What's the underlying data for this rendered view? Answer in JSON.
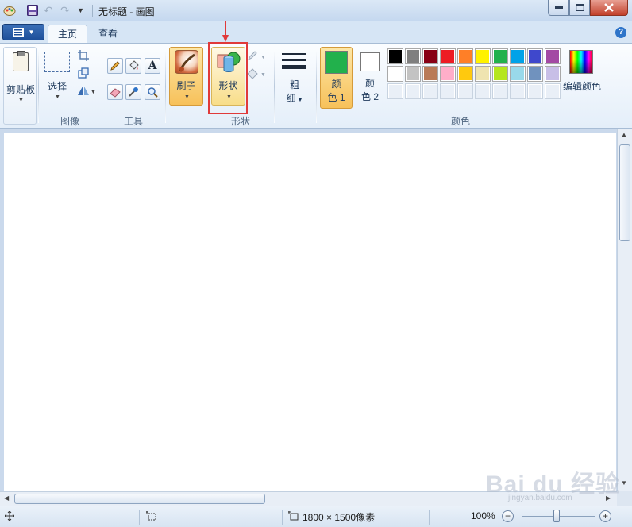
{
  "window": {
    "title": "无标题 - 画图"
  },
  "tabs": {
    "home": "主页",
    "view": "查看"
  },
  "ribbon": {
    "clipboard": {
      "label": "剪贴板"
    },
    "image": {
      "group_label": "图像",
      "select_label": "选择"
    },
    "tools": {
      "group_label": "工具"
    },
    "brushes": {
      "label": "刷子"
    },
    "shapes": {
      "label": "形状",
      "group_label": "形状"
    },
    "size": {
      "label_line1": "粗",
      "label_line2": "细"
    },
    "colors": {
      "group_label": "颜色",
      "color1": {
        "line1": "颜",
        "line2": "色 1",
        "value": "#22b14c"
      },
      "color2": {
        "line1": "颜",
        "line2": "色 2",
        "value": "#ffffff"
      },
      "edit_colors_label": "编辑颜色",
      "palette_row1": [
        "#000000",
        "#7f7f7f",
        "#880015",
        "#ed1c24",
        "#ff7f27",
        "#fff200",
        "#22b14c",
        "#00a2e8",
        "#3f48cc",
        "#a349a4"
      ],
      "palette_row2": [
        "#ffffff",
        "#c3c3c3",
        "#b97a57",
        "#ffaec9",
        "#ffc90e",
        "#efe4b0",
        "#b5e61d",
        "#99d9ea",
        "#7092be",
        "#c8bfe7"
      ]
    }
  },
  "status": {
    "dimensions": "1800 × 1500像素",
    "zoom": "100%"
  },
  "watermark": {
    "text": "Bai du 经验",
    "sub": "jingyan.baidu.com"
  },
  "annotation": {
    "highlight_color": "#e03a3a"
  }
}
